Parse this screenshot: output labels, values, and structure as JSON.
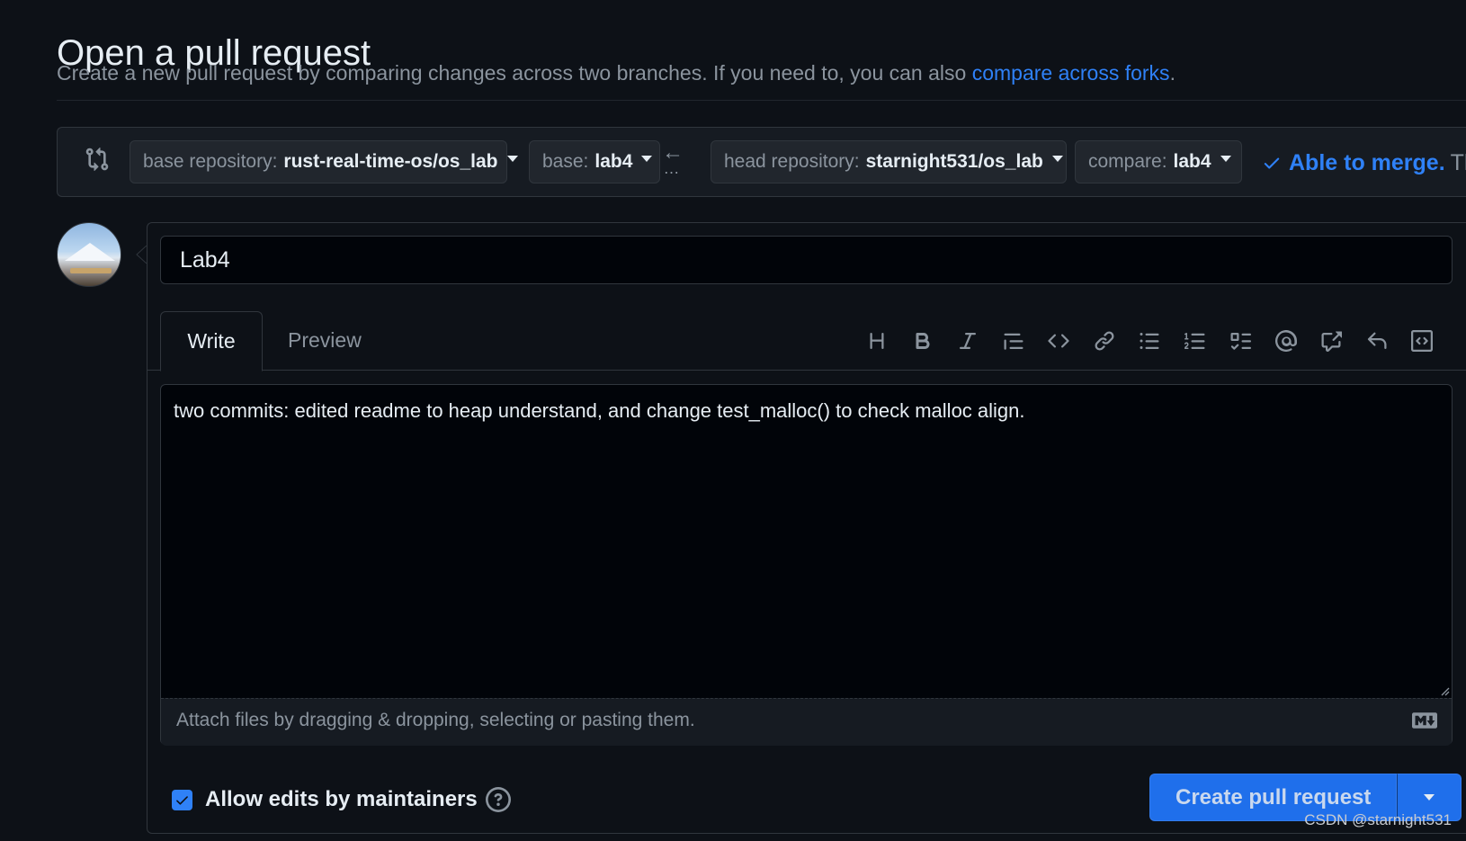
{
  "header": {
    "title": "Open a pull request",
    "subtitle_text": "Create a new pull request by comparing changes across two branches. If you need to, you can also ",
    "subtitle_link": "compare across forks",
    "subtitle_end": "."
  },
  "range": {
    "base_repo_label": "base repository:",
    "base_repo_value": "rust-real-time-os/os_lab",
    "base_label": "base:",
    "base_value": "lab4",
    "arrow": "←",
    "dots": "…",
    "head_repo_label": "head repository:",
    "head_repo_value": "starnight531/os_lab",
    "compare_label": "compare:",
    "compare_value": "lab4",
    "merge_status": "Able to merge.",
    "merge_rest": "Th"
  },
  "form": {
    "title_value": "Lab4",
    "tabs": [
      {
        "label": "Write",
        "active": true
      },
      {
        "label": "Preview",
        "active": false
      }
    ],
    "toolbar": [
      "heading-icon",
      "bold-icon",
      "italic-icon",
      "quote-icon",
      "code-icon",
      "link-icon",
      "unordered-list-icon",
      "ordered-list-icon",
      "task-list-icon",
      "mention-icon",
      "cross-reference-icon",
      "reply-icon",
      "slash-commands-icon"
    ],
    "body_value": "two commits: edited readme to heap understand, and change test_malloc() to check malloc align.",
    "attach_text": "Attach files by dragging & dropping, selecting or pasting them.",
    "allow_edits_label": "Allow edits by maintainers",
    "allow_edits_checked": true,
    "create_button": "Create pull request"
  },
  "watermark": "CSDN @starnight531",
  "colors": {
    "background": "#0d1117",
    "link": "#2f81f7",
    "primary_button": "#1f6feb"
  }
}
